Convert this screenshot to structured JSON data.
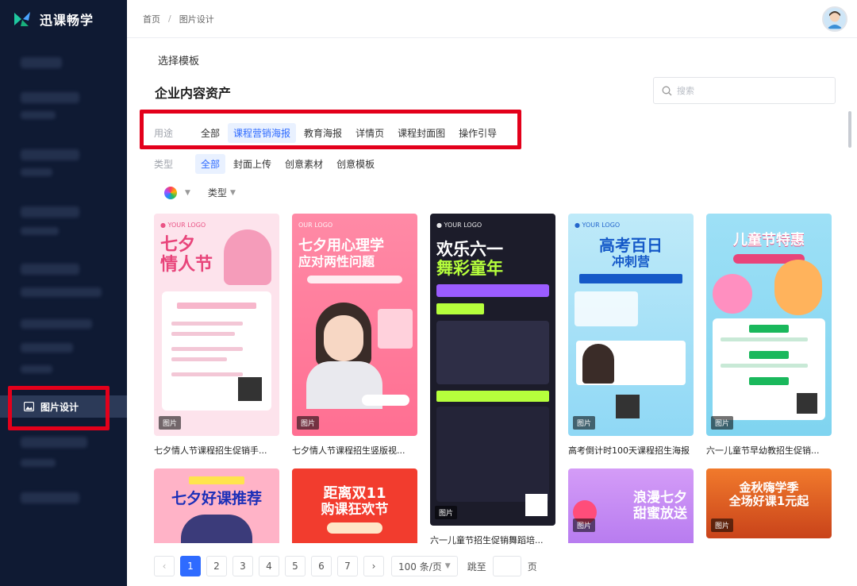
{
  "brand": {
    "name": "迅课畅学",
    "color": "#20c997"
  },
  "sidebar": {
    "active_label": "图片设计",
    "active_icon": "image-icon"
  },
  "breadcrumb": {
    "home": "首页",
    "separator": "/",
    "current": "图片设计"
  },
  "page": {
    "section_label": "选择模板",
    "title": "企业内容资产"
  },
  "search": {
    "placeholder": "搜索"
  },
  "filters": {
    "purpose": {
      "label": "用途",
      "options": [
        "全部",
        "课程营销海报",
        "教育海报",
        "详情页",
        "课程封面图",
        "操作引导"
      ],
      "active_index": 1
    },
    "type": {
      "label": "类型",
      "options": [
        "全部",
        "封面上传",
        "创意素材",
        "创意模板"
      ],
      "active_index": 0
    }
  },
  "toolbar": {
    "type_label": "类型"
  },
  "cards": [
    {
      "caption": "七夕情人节课程招生促销手...",
      "tag": "图片",
      "lines": [
        "七夕",
        "情人节"
      ],
      "bg": "#fde3ec",
      "fg": "#e8447a"
    },
    {
      "caption": "七夕情人节课程招生竖版视...",
      "tag": "图片",
      "lines": [
        "七夕用心理学",
        "应对两性问题"
      ],
      "bg": "#ff7a9a",
      "fg": "#ffffff"
    },
    {
      "caption": "六一儿童节招生促销舞蹈培...",
      "tag": "图片",
      "lines": [
        "欢乐六一",
        "舞彩童年"
      ],
      "bg": "#1c1c2a",
      "fg": "#b6ff3c"
    },
    {
      "caption": "高考倒计时100天课程招生海报",
      "tag": "图片",
      "lines": [
        "高考百日",
        "冲刺营"
      ],
      "bg": "#8fd8f5",
      "fg": "#1559c8"
    },
    {
      "caption": "六一儿童节早幼教招生促销...",
      "tag": "图片",
      "lines": [
        "儿童节特惠"
      ],
      "bg": "#7fd4f0",
      "fg": "#ffffff"
    },
    {
      "caption": "",
      "tag": "",
      "lines": [
        "七夕好课推荐"
      ],
      "bg": "#ffb3c7",
      "fg": "#1b2fb8"
    },
    {
      "caption": "",
      "tag": "",
      "lines": [
        "距离双11",
        "购课狂欢节"
      ],
      "bg": "#f23c2e",
      "fg": "#ffffff"
    },
    {
      "caption": "",
      "tag": "图片",
      "lines": [
        "浪漫七夕",
        "甜蜜放送"
      ],
      "bg": "#b87cf0",
      "fg": "#ffffff"
    },
    {
      "caption": "",
      "tag": "图片",
      "lines": [
        "金秋嗨学季",
        "全场好课1元起"
      ],
      "bg": "#d9541a",
      "fg": "#ffffff"
    }
  ],
  "pagination": {
    "pages": [
      "1",
      "2",
      "3",
      "4",
      "5",
      "6",
      "7"
    ],
    "active": "1",
    "page_size": "100 条/页",
    "jump_label": "跳至",
    "page_unit": "页"
  },
  "colors": {
    "accent": "#2f6bff",
    "sidebar_bg": "#0f1a33",
    "highlight_red": "#e3001b"
  }
}
